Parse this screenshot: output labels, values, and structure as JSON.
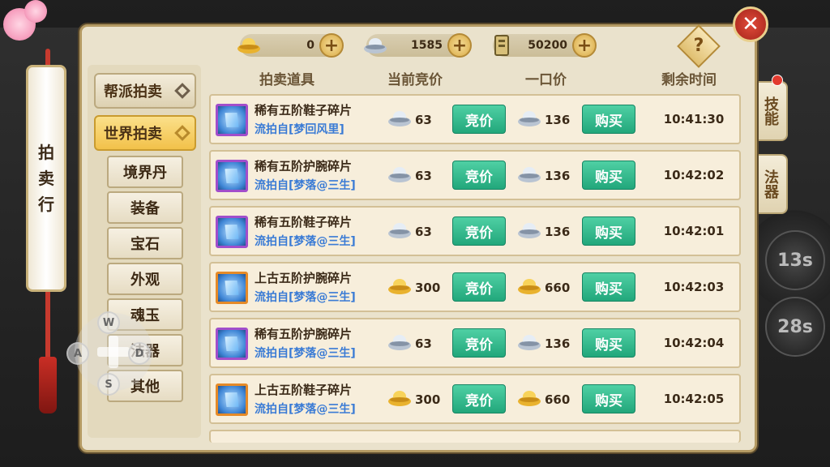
{
  "title": "拍卖行",
  "title_chars": [
    "拍",
    "卖",
    "行"
  ],
  "currencies": [
    {
      "name": "gold-ingot",
      "value": "0"
    },
    {
      "name": "silver-ingot",
      "value": "1585"
    },
    {
      "name": "note",
      "value": "50200"
    }
  ],
  "help_label": "?",
  "close_label": "✕",
  "categories": {
    "guild": "帮派拍卖",
    "world": "世界拍卖",
    "subs": [
      "境界丹",
      "装备",
      "宝石",
      "外观",
      "魂玉",
      "法器",
      "其他"
    ]
  },
  "headers": {
    "item": "拍卖道具",
    "current_bid": "当前竞价",
    "buyout": "一口价",
    "remaining": "剩余时间"
  },
  "buttons": {
    "bid": "竞价",
    "buy": "购买"
  },
  "rows": [
    {
      "name": "稀有五阶鞋子碎片",
      "source": "流拍自[梦回风里]",
      "rarity": "purple",
      "currency": "silver",
      "bid": "63",
      "buyout": "136",
      "time": "10:41:30"
    },
    {
      "name": "稀有五阶护腕碎片",
      "source": "流拍自[梦落@三生]",
      "rarity": "purple",
      "currency": "silver",
      "bid": "63",
      "buyout": "136",
      "time": "10:42:02"
    },
    {
      "name": "稀有五阶鞋子碎片",
      "source": "流拍自[梦落@三生]",
      "rarity": "purple",
      "currency": "silver",
      "bid": "63",
      "buyout": "136",
      "time": "10:42:01"
    },
    {
      "name": "上古五阶护腕碎片",
      "source": "流拍自[梦落@三生]",
      "rarity": "orange",
      "currency": "gold",
      "bid": "300",
      "buyout": "660",
      "time": "10:42:03"
    },
    {
      "name": "稀有五阶护腕碎片",
      "source": "流拍自[梦落@三生]",
      "rarity": "purple",
      "currency": "silver",
      "bid": "63",
      "buyout": "136",
      "time": "10:42:04"
    },
    {
      "name": "上古五阶鞋子碎片",
      "source": "流拍自[梦落@三生]",
      "rarity": "orange",
      "currency": "gold",
      "bid": "300",
      "buyout": "660",
      "time": "10:42:05"
    }
  ],
  "side_tabs": [
    "技能",
    "法器"
  ],
  "skills": [
    "13s",
    "28s"
  ],
  "dpad": {
    "up": "W",
    "left": "A",
    "right": "D",
    "down": "S"
  },
  "colors": {
    "accent_green": "#22a77b",
    "panel": "#eae2cc",
    "source_blue": "#3a7bd5"
  }
}
